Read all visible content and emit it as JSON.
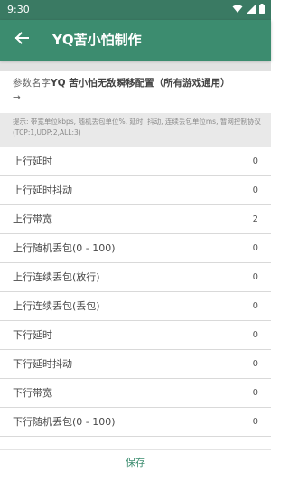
{
  "status_bar": {
    "time": "9:30",
    "icons": [
      "wifi-icon",
      "signal-icon",
      "battery-icon"
    ]
  },
  "app_bar": {
    "title": "YQ苦小怕制作",
    "back_icon": "back-arrow-icon"
  },
  "config": {
    "name_label": "参数名字",
    "name_value": "YQ 苦小怕无敌瞬移配置（所有游戏通用）",
    "arrow": "→"
  },
  "hint": "提示: 带宽单位kbps, 随机丢包单位%, 延时, 抖动, 连续丢包单位ms, 暂网控制协议(TCP:1,UDP:2,ALL:3)",
  "params": [
    {
      "label": "上行延时",
      "value": "0"
    },
    {
      "label": "上行延时抖动",
      "value": "0"
    },
    {
      "label": "上行带宽",
      "value": "2"
    },
    {
      "label": "上行随机丢包(0 - 100)",
      "value": "0"
    },
    {
      "label": "上行连续丢包(放行)",
      "value": "0"
    },
    {
      "label": "上行连续丢包(丢包)",
      "value": "0"
    },
    {
      "label": "下行延时",
      "value": "0"
    },
    {
      "label": "下行延时抖动",
      "value": "0"
    },
    {
      "label": "下行带宽",
      "value": "0"
    },
    {
      "label": "下行随机丢包(0 - 100)",
      "value": "0"
    }
  ],
  "footer": {
    "save_label": "保存"
  },
  "colors": {
    "status_bar": "#3a7a63",
    "app_bar": "#3c8c6f",
    "accent": "#3c8c6f",
    "hint_background": "#e9e9e9"
  }
}
